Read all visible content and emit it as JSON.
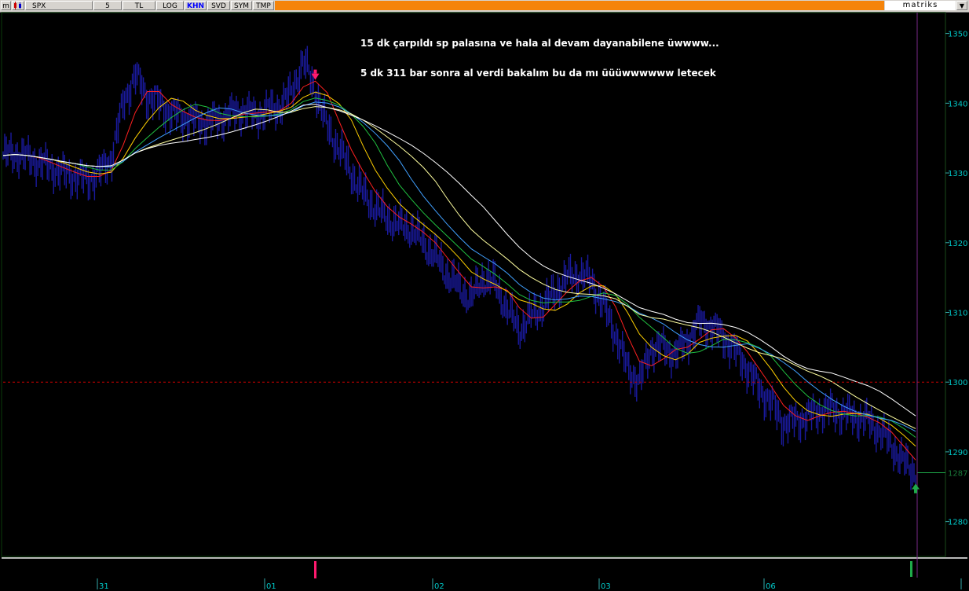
{
  "toolbar": {
    "menu_icon": "m",
    "symbol": "SPX",
    "period": "5",
    "currency": "TL",
    "log": "LOG",
    "khn": "KHN",
    "svd": "SVD",
    "sym": "SYM",
    "tmp": "TMP",
    "brand": "matriks",
    "dropdown_icon": "▼"
  },
  "annotations": {
    "line1": "15 dk çarpıldı sp palasına ve hala al devam dayanabilene üwwww...",
    "line2": "5 dk 311 bar sonra al verdi bakalım bu da mı üüüwwwwww letecek"
  },
  "price_axis": {
    "ticks": [
      "1350",
      "1340",
      "1330",
      "1320",
      "1310",
      "1300",
      "1290",
      "1280"
    ],
    "last_label": "1287"
  },
  "date_axis": {
    "labels": [
      "31",
      "01",
      "02",
      "03",
      "06"
    ]
  },
  "colors": {
    "background": "#000000",
    "bars": "#1a1a9e",
    "axis_text": "#00c8c8",
    "reference_line": "#cc0000",
    "sell_signal": "#ff1a6e",
    "buy_signal": "#1faa4a",
    "cursor_line": "#7a2a8a",
    "ma_colors": [
      "#ff2020",
      "#ffd000",
      "#20c040",
      "#40a0ff",
      "#ffffa0",
      "#ffffff"
    ]
  },
  "chart_data": {
    "type": "line",
    "symbol": "SPX",
    "interval_min": 5,
    "ylim": [
      1275,
      1353
    ],
    "reference_line": 1300,
    "last_price": 1287,
    "sessions": [
      "31",
      "01",
      "02",
      "03",
      "06"
    ],
    "close": [
      1332.5,
      1332.8,
      1332.2,
      1331.5,
      1330.8,
      1330,
      1329.5,
      1329,
      1330,
      1332,
      1340,
      1344,
      1341,
      1340,
      1338.5,
      1338,
      1337.5,
      1337.2,
      1337.8,
      1338.5,
      1339,
      1338.2,
      1339,
      1339.5,
      1341.5,
      1346,
      1342,
      1336.5,
      1333.5,
      1330,
      1327,
      1325,
      1323.5,
      1322.5,
      1322,
      1320,
      1318,
      1315.5,
      1313.5,
      1312,
      1315,
      1314,
      1310.5,
      1307.5,
      1309.5,
      1311,
      1313,
      1315,
      1315.5,
      1314.5,
      1311,
      1307,
      1302,
      1300,
      1305,
      1305,
      1304,
      1306,
      1308.5,
      1308,
      1306.5,
      1304.5,
      1302,
      1299,
      1297,
      1294,
      1294.5,
      1295,
      1296,
      1296,
      1295.5,
      1295,
      1294.5,
      1293,
      1291,
      1288.5,
      1287
    ],
    "ma_periods": [
      3,
      5,
      7,
      9,
      12,
      16
    ],
    "signals": [
      {
        "type": "sell",
        "index": 26
      },
      {
        "type": "buy",
        "index": 76
      }
    ]
  }
}
